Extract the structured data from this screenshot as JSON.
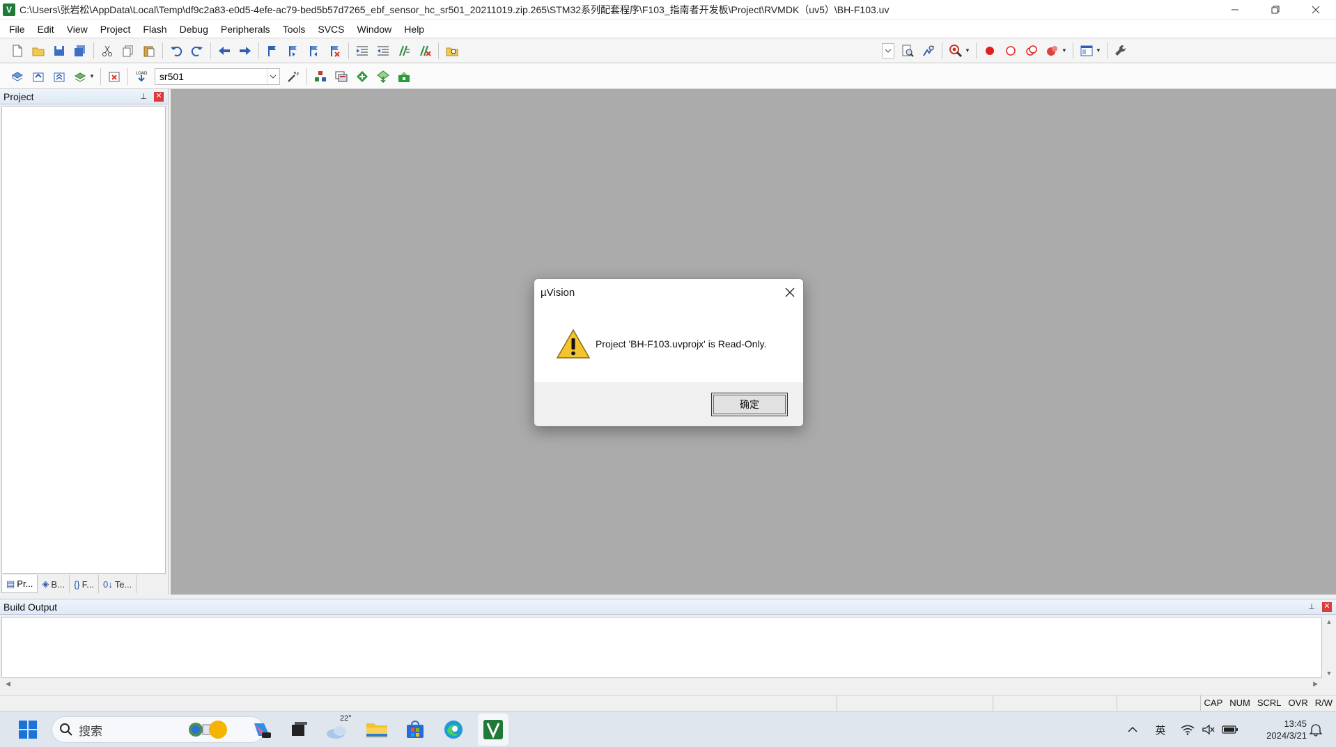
{
  "window": {
    "title": "C:\\Users\\张岩松\\AppData\\Local\\Temp\\df9c2a83-e0d5-4efe-ac79-bed5b57d7265_ebf_sensor_hc_sr501_20211019.zip.265\\STM32系列配套程序\\F103_指南者开发板\\Project\\RVMDK（uv5）\\BH-F103.uv",
    "app_icon_label": "V"
  },
  "menu": [
    "File",
    "Edit",
    "View",
    "Project",
    "Flash",
    "Debug",
    "Peripherals",
    "Tools",
    "SVCS",
    "Window",
    "Help"
  ],
  "toolbar2": {
    "load_label": "LOAD",
    "target_value": "sr501"
  },
  "project_pane": {
    "title": "Project",
    "tabs": [
      {
        "icon": "▤",
        "label": "Pr..."
      },
      {
        "icon": "◈",
        "label": "B..."
      },
      {
        "icon": "{}",
        "label": "F..."
      },
      {
        "icon": "0↓",
        "label": "Te..."
      }
    ]
  },
  "dialog": {
    "title": "µVision",
    "message": "Project 'BH-F103.uvprojx' is Read-Only.",
    "ok_label": "确定"
  },
  "build_output": {
    "title": "Build Output"
  },
  "status_bar": [
    "CAP",
    "NUM",
    "SCRL",
    "OVR",
    "R/W"
  ],
  "taskbar": {
    "search_placeholder": "搜索",
    "weather_temp": "22°",
    "input_method": "英",
    "time": "13:45",
    "date": "2024/3/21"
  },
  "colors": {
    "workspace": "#ababab",
    "close_red": "#d93a3a",
    "app_green": "#1f7a3a"
  }
}
